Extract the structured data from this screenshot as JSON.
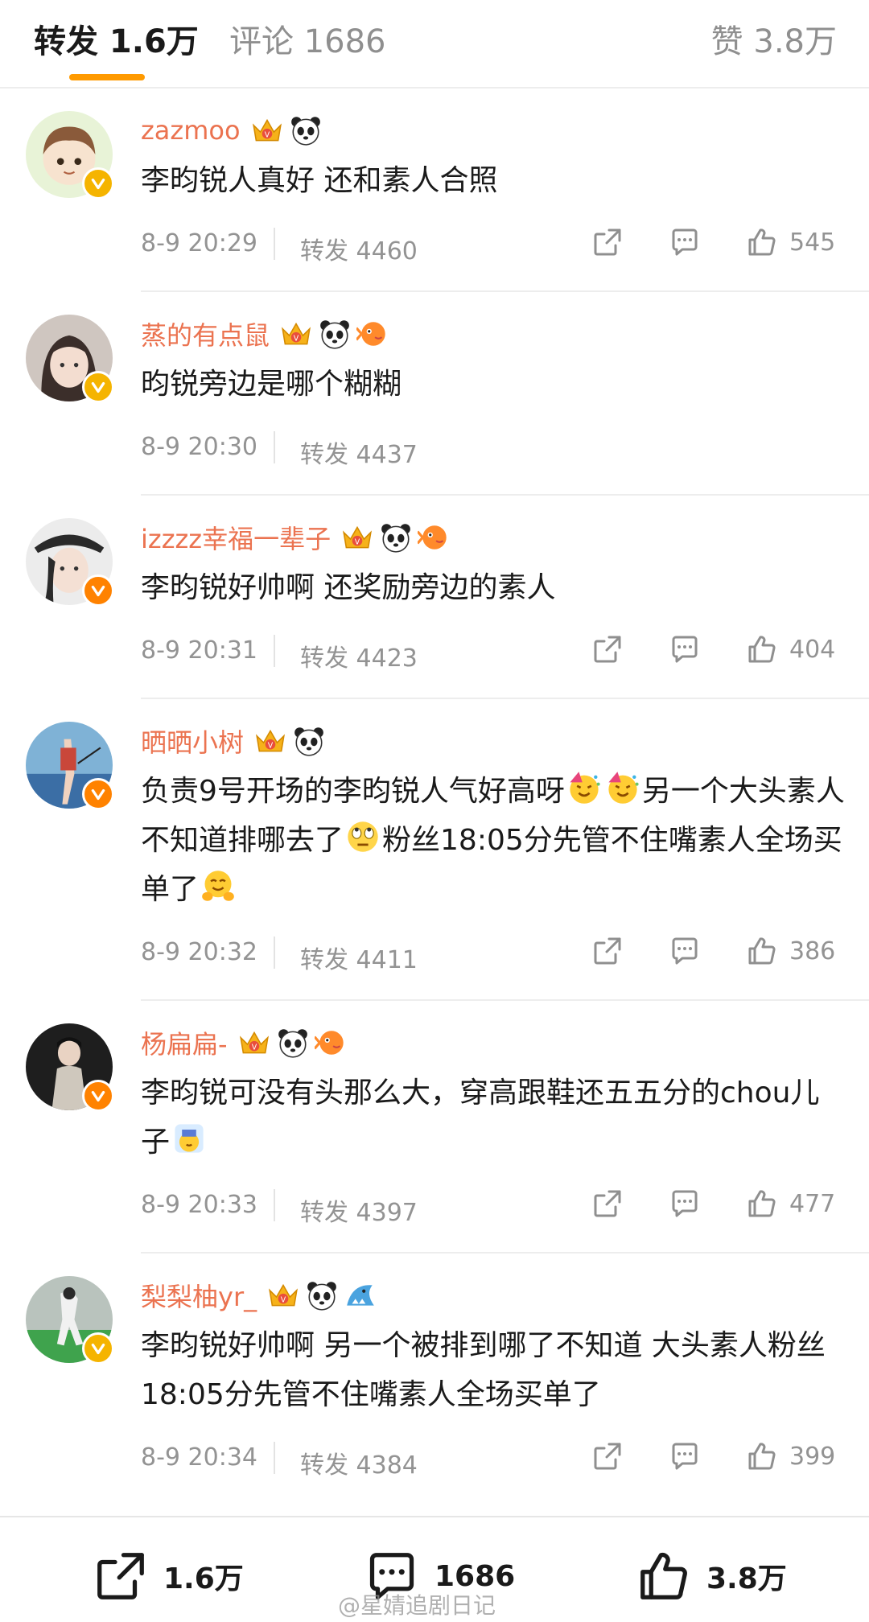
{
  "tabs": {
    "repost": "转发 1.6万",
    "comment": "评论 1686",
    "like": "赞 3.8万"
  },
  "colors": {
    "accent": "#ff9a00",
    "username": "#eb7350",
    "verified_gold": "#f5b400",
    "verified_orange": "#ff8200"
  },
  "comments": [
    {
      "name": "zazmoo",
      "text": "李昀锐人真好 还和素人合照",
      "time": "8-9 20:29",
      "repost": "转发 4460",
      "likes": "545",
      "verified": "gold",
      "badges": [
        "crown-badge",
        "panda-badge"
      ]
    },
    {
      "name": "蒸的有点鼠",
      "text": "昀锐旁边是哪个糊糊",
      "time": "8-9 20:30",
      "repost": "转发 4437",
      "likes": "",
      "verified": "gold",
      "badges": [
        "crown-badge",
        "panda-badge",
        "fish-badge"
      ]
    },
    {
      "name": "izzzz幸福一辈子",
      "text": "李昀锐好帅啊 还奖励旁边的素人",
      "time": "8-9 20:31",
      "repost": "转发 4423",
      "likes": "404",
      "verified": "orange",
      "badges": [
        "crown-badge",
        "panda-badge",
        "fish-badge"
      ]
    },
    {
      "name": "晒晒小树",
      "text_parts": [
        "负责9号开场的李昀锐人气好高呀",
        "另一个大头素人不知道排哪去了",
        "粉丝18:05分先管不住嘴素人全场买单了"
      ],
      "time": "8-9 20:32",
      "repost": "转发 4411",
      "likes": "386",
      "verified": "orange",
      "badges": [
        "crown-badge",
        "panda-badge"
      ],
      "emojis": [
        "party-face-emoji",
        "party-face-emoji",
        "eye-roll-emoji",
        "hug-emoji"
      ]
    },
    {
      "name": "杨扁扁-",
      "text_parts": [
        "李昀锐可没有头那么大，穿高跟鞋还五五分的chou儿子"
      ],
      "time": "8-9 20:33",
      "repost": "转发 4397",
      "likes": "477",
      "verified": "orange",
      "badges": [
        "crown-badge",
        "panda-badge",
        "fish-badge"
      ],
      "emojis": [
        "facepalm-emoji"
      ]
    },
    {
      "name": "梨梨柚yr_",
      "text": "李昀锐好帅啊 另一个被排到哪了不知道 大头素人粉丝18:05分先管不住嘴素人全场买单了",
      "time": "8-9 20:34",
      "repost": "转发 4384",
      "likes": "399",
      "verified": "gold",
      "badges": [
        "crown-badge",
        "panda-badge",
        "shark-badge"
      ]
    }
  ],
  "bottom": {
    "repost": "1.6万",
    "comment": "1686",
    "like": "3.8万",
    "watermark": "@星婧追剧日记"
  }
}
